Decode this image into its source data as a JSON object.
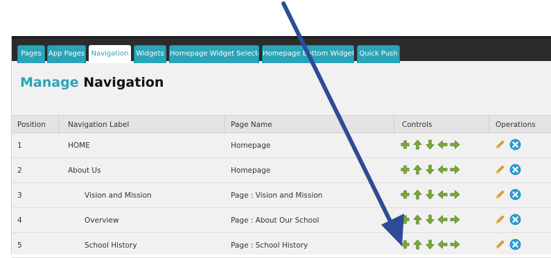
{
  "tabs": [
    {
      "label": "Pages",
      "active": false
    },
    {
      "label": "App Pages",
      "active": false
    },
    {
      "label": "Navigation",
      "active": true
    },
    {
      "label": "Widgets",
      "active": false
    },
    {
      "label": "Homepage Widget Selector",
      "active": false
    },
    {
      "label": "Homepage Bottom Widgets",
      "active": false
    },
    {
      "label": "Quick Push",
      "active": false
    }
  ],
  "page_title": {
    "accent": "Manage",
    "rest": " Navigation"
  },
  "table": {
    "headers": [
      "Position",
      "Navigation Label",
      "Page Name",
      "Controls",
      "Operations"
    ],
    "rows": [
      {
        "position": "1",
        "label": "HOME",
        "page": "Homepage",
        "indent": false
      },
      {
        "position": "2",
        "label": "About Us",
        "page": "Homepage",
        "indent": false
      },
      {
        "position": "3",
        "label": "Vision and Mission",
        "page": "Page : Vision and Mission",
        "indent": true
      },
      {
        "position": "4",
        "label": "Overview",
        "page": "Page : About Our School",
        "indent": true
      },
      {
        "position": "5",
        "label": "School History",
        "page": "Page : School History",
        "indent": true
      }
    ]
  },
  "icons": {
    "controls": [
      "plus-icon",
      "up-arrow-icon",
      "down-arrow-icon",
      "left-arrow-icon",
      "right-arrow-icon"
    ],
    "operations": [
      "edit-pencil-icon",
      "delete-circle-icon"
    ]
  },
  "colors": {
    "accent": "#2aa4b8",
    "control_green": "#7aa83a",
    "pencil": "#e8a72c",
    "delete_blue": "#2a9fd8",
    "annotation_arrow": "#2d4c94"
  }
}
